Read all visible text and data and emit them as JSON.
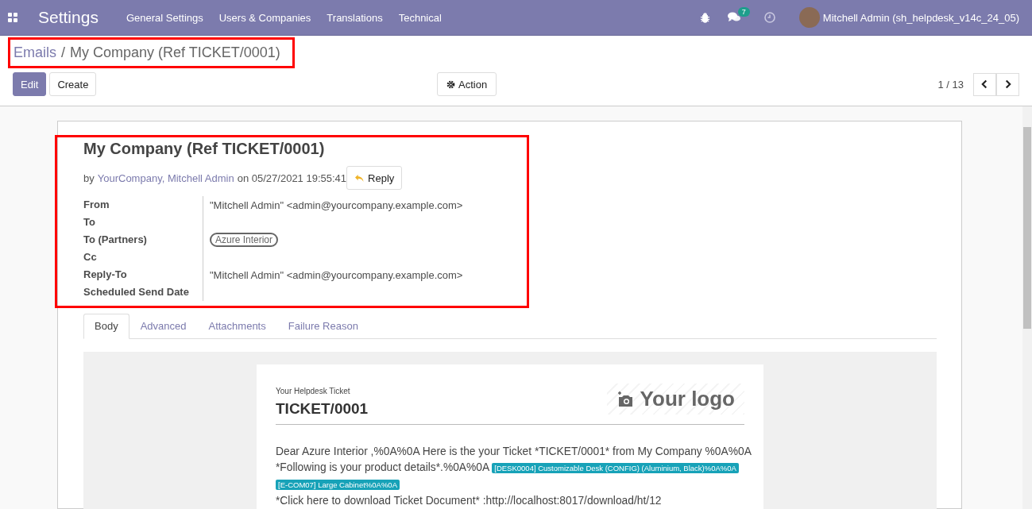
{
  "navbar": {
    "app_title": "Settings",
    "menus": [
      "General Settings",
      "Users & Companies",
      "Translations",
      "Technical"
    ],
    "message_count": "7",
    "user": "Mitchell Admin (sh_helpdesk_v14c_24_05)"
  },
  "breadcrumb": {
    "parent": "Emails",
    "separator": "/",
    "current": "My Company (Ref TICKET/0001)"
  },
  "buttons": [
    {
      "label": "Edit",
      "kind": "primary"
    },
    {
      "label": "Create",
      "kind": "secondary"
    }
  ],
  "action": "Action",
  "pager": "1 / 13",
  "message": {
    "subject": "My Company (Ref TICKET/0001)",
    "by": "by",
    "authors": "YourCompany, Mitchell Admin",
    "date": "on 05/27/2021 19:55:41",
    "reply": "Reply"
  },
  "fields": [
    {
      "label": "From",
      "kind": "text",
      "value": "\"Mitchell Admin\" <admin@yourcompany.example.com>"
    },
    {
      "label": "To",
      "kind": "empty"
    },
    {
      "label": "To (Partners)",
      "kind": "tag",
      "value": "Azure Interior"
    },
    {
      "label": "Cc",
      "kind": "empty"
    },
    {
      "label": "Reply-To",
      "kind": "text",
      "value": "\"Mitchell Admin\" <admin@yourcompany.example.com>"
    },
    {
      "label": "Scheduled Send Date",
      "kind": "empty"
    }
  ],
  "tabs": [
    {
      "label": "Body",
      "selected": true
    },
    {
      "label": "Advanced",
      "selected": false
    },
    {
      "label": "Attachments",
      "selected": false
    },
    {
      "label": "Failure Reason",
      "selected": false
    }
  ],
  "email": {
    "kicker": "Your Helpdesk Ticket",
    "ticket": "TICKET/0001",
    "logo": "Your logo",
    "body": [
      {
        "kind": "text",
        "text": "Dear Azure Interior ,%0A%0A Here is the your Ticket *TICKET/0001* from My Company %0A%0A"
      },
      {
        "kind": "text",
        "text": "*Following is your product details*.%0A%0A"
      },
      {
        "kind": "tag",
        "text": "[DESK0004] Customizable Desk (CONFIG) (Aluminium, Black)%0A%0A"
      },
      {
        "kind": "tag",
        "text": "[E-COM07] Large Cabinet%0A%0A"
      },
      {
        "kind": "text",
        "text": "*Click here to download Ticket Document* :http://localhost:8017/download/ht/12"
      }
    ]
  }
}
